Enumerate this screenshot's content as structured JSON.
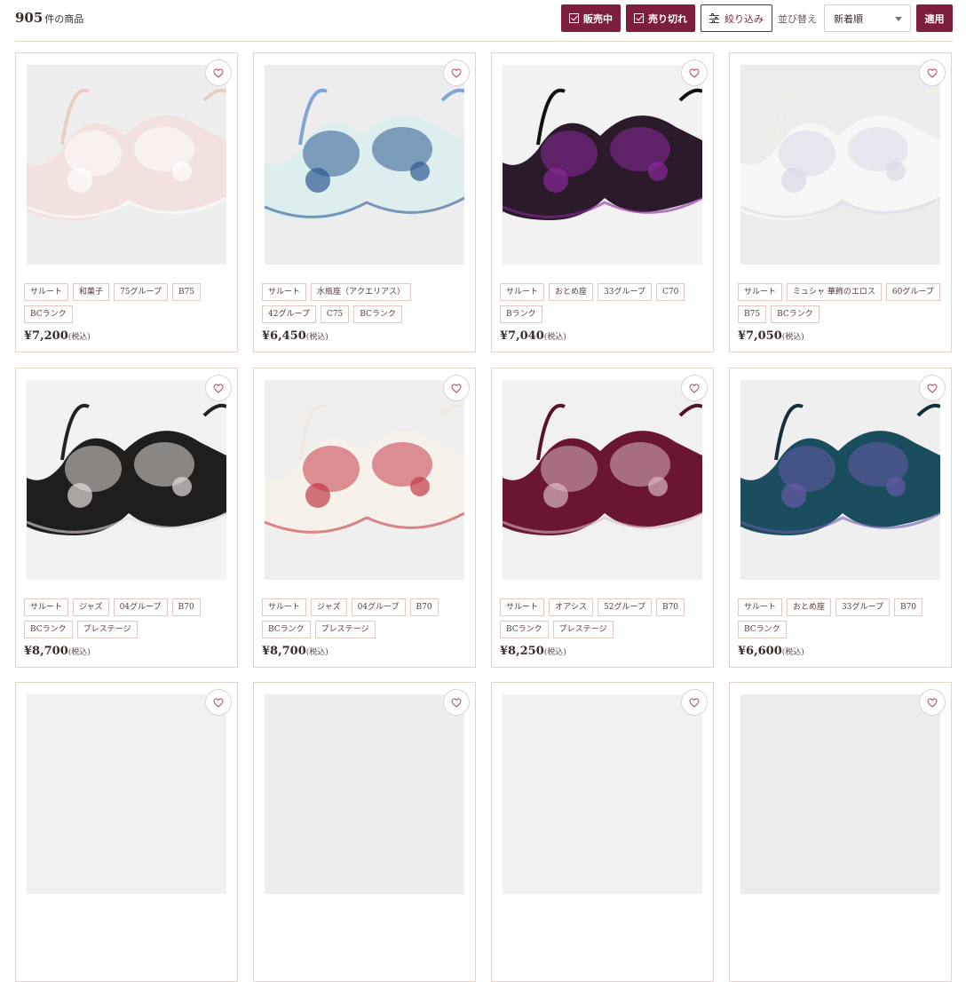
{
  "header": {
    "count": "905",
    "count_unit": "件の商品",
    "on_sale_label": "販売中",
    "sold_out_label": "売り切れ",
    "filter_label": "絞り込み",
    "sort_label": "並び替え",
    "sort_value": "新着順",
    "apply_label": "適用"
  },
  "colors": {
    "accent": "#7d1f3c",
    "tag_border": "#e3c9c4",
    "card_border": "#e3d3cc"
  },
  "products": [
    {
      "tags": [
        "サルート",
        "和菓子",
        "75グループ",
        "B75",
        "BCランク"
      ],
      "price": "¥7,200",
      "tax": "(税込)",
      "palette": {
        "bg": "#eeeeee",
        "cup": "#f2e1de",
        "lace": "#ffffff",
        "strap": "#e8cfc4"
      }
    },
    {
      "tags": [
        "サルート",
        "水瓶座（アクエリアス）",
        "42グループ",
        "C75",
        "BCランク"
      ],
      "price": "¥6,450",
      "tax": "(税込)",
      "palette": {
        "bg": "#ededed",
        "cup": "#dceeee",
        "lace": "#2d5a92",
        "strap": "#7ea6d6"
      }
    },
    {
      "tags": [
        "サルート",
        "おとめ座",
        "33グループ",
        "C70",
        "Bランク"
      ],
      "price": "¥7,040",
      "tax": "(税込)",
      "palette": {
        "bg": "#f2f2f2",
        "cup": "#2a1a2a",
        "lace": "#8a2a9a",
        "strap": "#111111"
      }
    },
    {
      "tags": [
        "サルート",
        "ミュシャ 華飾のエロス",
        "60グループ",
        "B75",
        "BCランク"
      ],
      "price": "¥7,050",
      "tax": "(税込)",
      "palette": {
        "bg": "#ececec",
        "cup": "#f7f7f5",
        "lace": "#d8d8ea",
        "strap": "#f0efe6"
      }
    },
    {
      "tags": [
        "サルート",
        "ジャズ",
        "04グループ",
        "B70",
        "BCランク",
        "プレステージ"
      ],
      "price": "¥8,700",
      "tax": "(税込)",
      "palette": {
        "bg": "#f2f2f2",
        "cup": "#1e1e1e",
        "lace": "#e4dcd8",
        "strap": "#222222"
      }
    },
    {
      "tags": [
        "サルート",
        "ジャズ",
        "04グループ",
        "B70",
        "BCランク",
        "プレステージ"
      ],
      "price": "¥8,700",
      "tax": "(税込)",
      "palette": {
        "bg": "#efefef",
        "cup": "#f6f2ea",
        "lace": "#c43a48",
        "strap": "#f0e8dc"
      }
    },
    {
      "tags": [
        "サルート",
        "オアシス",
        "52グループ",
        "B70",
        "BCランク",
        "プレステージ"
      ],
      "price": "¥8,250",
      "tax": "(税込)",
      "palette": {
        "bg": "#f1f1f1",
        "cup": "#6a1630",
        "lace": "#d8b8c4",
        "strap": "#5a1028"
      }
    },
    {
      "tags": [
        "サルート",
        "おとめ座",
        "33グループ",
        "B70",
        "BCランク"
      ],
      "price": "¥6,600",
      "tax": "(税込)",
      "palette": {
        "bg": "#efefef",
        "cup": "#1a4e5e",
        "lace": "#6a5aa8",
        "strap": "#15303a"
      }
    },
    {
      "tags": [],
      "price": "",
      "tax": "",
      "palette": {
        "bg": "#f0f0f0",
        "cup": "#f0f0f0",
        "lace": "#f0f0f0",
        "strap": "#f0f0f0"
      }
    },
    {
      "tags": [],
      "price": "",
      "tax": "",
      "palette": {
        "bg": "#eeeeee",
        "cup": "#eeeeee",
        "lace": "#eeeeee",
        "strap": "#eeeeee"
      }
    },
    {
      "tags": [],
      "price": "",
      "tax": "",
      "palette": {
        "bg": "#f1f1f1",
        "cup": "#f1f1f1",
        "lace": "#f1f1f1",
        "strap": "#f1f1f1"
      }
    },
    {
      "tags": [],
      "price": "",
      "tax": "",
      "palette": {
        "bg": "#ececec",
        "cup": "#ececec",
        "lace": "#ececec",
        "strap": "#ececec"
      }
    }
  ]
}
